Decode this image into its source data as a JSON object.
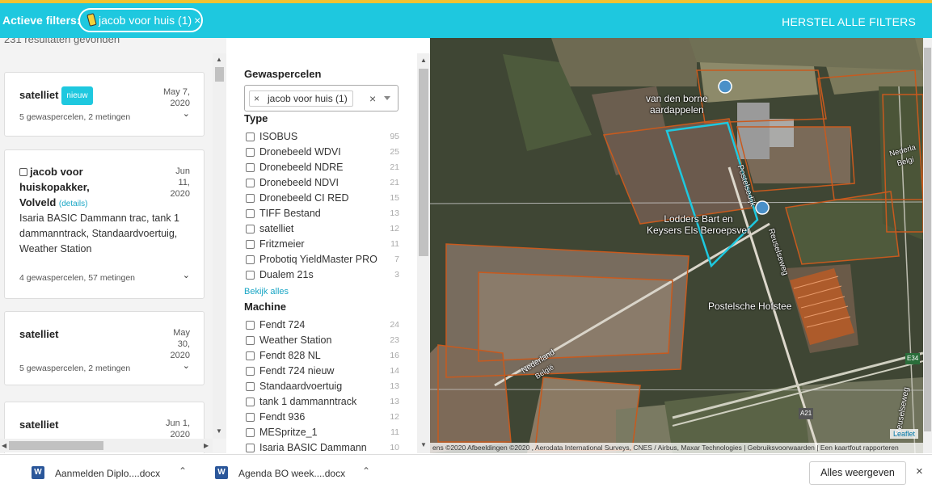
{
  "filterbar": {
    "label": "Actieve filters:",
    "chip_label": "jacob voor huis (1)",
    "chip_close": "×",
    "reset_label": "HERSTEL ALLE FILTERS"
  },
  "results": {
    "count_text": "231 resultaten gevonden",
    "cards": [
      {
        "title": "satelliet",
        "badge": "nieuw",
        "date_lines": [
          "May 7,",
          "2020"
        ],
        "summary": "5 gewaspercelen, 2 metingen"
      },
      {
        "title_lines": [
          "jacob voor",
          "huiskopakker,",
          "Volveld"
        ],
        "details": "(details)",
        "date_lines": [
          "Jun",
          "11,",
          "2020"
        ],
        "description": "Isaria BASIC Dammann trac, tank 1 dammanntrack, Standaardvoertuig, Weather Station",
        "summary": "4 gewaspercelen, 57 metingen"
      },
      {
        "title": "satelliet",
        "date_lines": [
          "May",
          "30,",
          "2020"
        ],
        "summary": "5 gewaspercelen, 2 metingen"
      },
      {
        "title": "satelliet",
        "date_lines": [
          "Jun 1,",
          "2020"
        ]
      }
    ]
  },
  "filters": {
    "gewaspercelen_title": "Gewaspercelen",
    "selected_tag": "jacob voor huis (1)",
    "tag_remove": "×",
    "clear": "×",
    "type_title": "Type",
    "types": [
      {
        "name": "ISOBUS",
        "count": "95"
      },
      {
        "name": "Dronebeeld WDVI",
        "count": "25"
      },
      {
        "name": "Dronebeeld NDRE",
        "count": "21"
      },
      {
        "name": "Dronebeeld NDVI",
        "count": "21"
      },
      {
        "name": "Dronebeeld CI RED",
        "count": "15"
      },
      {
        "name": "TIFF Bestand",
        "count": "13"
      },
      {
        "name": "satelliet",
        "count": "12"
      },
      {
        "name": "Fritzmeier",
        "count": "11"
      },
      {
        "name": "Probotiq YieldMaster PRO",
        "count": "7"
      },
      {
        "name": "Dualem 21s",
        "count": "3"
      }
    ],
    "see_all": "Bekijk alles",
    "machine_title": "Machine",
    "machines": [
      {
        "name": "Fendt 724",
        "count": "24"
      },
      {
        "name": "Weather Station",
        "count": "23"
      },
      {
        "name": "Fendt 828 NL",
        "count": "16"
      },
      {
        "name": "Fendt 724 nieuw",
        "count": "14"
      },
      {
        "name": "Standaardvoertuig",
        "count": "13"
      },
      {
        "name": "tank 1 dammanntrack",
        "count": "13"
      },
      {
        "name": "Fendt 936",
        "count": "12"
      },
      {
        "name": "MESpritze_1",
        "count": "11"
      },
      {
        "name": "Isaria BASIC Dammann",
        "count": "10"
      }
    ]
  },
  "map": {
    "labels": {
      "borne": [
        "van den borne",
        "aardappelen"
      ],
      "lodders": [
        "Lodders Bart en",
        "Keysers Els Beroepsver"
      ],
      "hofstee": "Postelsche Hofstee",
      "postelsedijk": "Postelsedijk",
      "reuselseweg": "Reuselseweg",
      "reuselseweg2": "Reuselseweg",
      "nederland": "Nederland",
      "belgie": "België",
      "nederlandbelgie": [
        "Nederla",
        "Belgi"
      ],
      "e34": "E34",
      "a21": "A21"
    },
    "attribution": "ens ©2020 Afbeeldingen ©2020 , Aerodata International Surveys, CNES / Airbus, Maxar Technologies | Gebruiksvoorwaarden | Een kaartfout rapporteren",
    "leaflet": "Leaflet"
  },
  "downloads": {
    "items": [
      {
        "name": "Aanmelden Diplo....docx",
        "icon": "word-icon"
      },
      {
        "name": "Agenda BO week....docx",
        "icon": "word-icon"
      }
    ],
    "show_all": "Alles weergeven",
    "close": "×"
  }
}
